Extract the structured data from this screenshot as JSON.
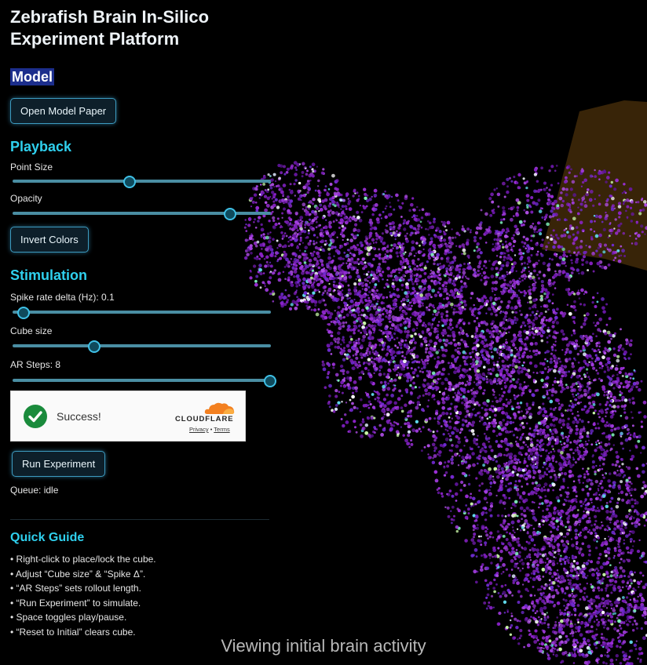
{
  "title_line1": "Zebrafish Brain In-Silico",
  "title_line2": "Experiment Platform",
  "model": {
    "heading": "Model",
    "open_paper_label": "Open Model Paper"
  },
  "playback": {
    "heading": "Playback",
    "point_size_label": "Point Size",
    "point_size_level": 0.44,
    "opacity_label": "Opacity",
    "opacity_level": 0.84,
    "invert_colors_label": "Invert Colors"
  },
  "stimulation": {
    "heading": "Stimulation",
    "spike_rate_label": "Spike rate delta (Hz): 0.1",
    "spike_rate_level": 0.02,
    "cube_size_label": "Cube size",
    "cube_size_level": 0.3,
    "ar_steps_label": "AR Steps: 8",
    "ar_steps_level": 1.0
  },
  "captcha": {
    "status": "Success!",
    "brand": "CLOUDFLARE",
    "privacy": "Privacy",
    "separator": "•",
    "terms": "Terms"
  },
  "run_label": "Run Experiment",
  "queue_status": "Queue: idle",
  "guide": {
    "heading": "Quick Guide",
    "items": [
      "• Right-click to place/lock the cube.",
      "• Adjust “Cube size” & “Spike Δ”.",
      "• “AR Steps” sets rollout length.",
      "• “Run Experiment” to simulate.",
      "• Space toggles play/pause.",
      "• “Reset to Initial” clears cube."
    ]
  },
  "caption": "Viewing initial brain activity",
  "colors": {
    "accent": "#2fd0ee",
    "point_purple": "#7a1fb8",
    "cube_brown": "#3b2608",
    "success_green": "#1a8b3c",
    "cloudflare_orange": "#f38020"
  }
}
